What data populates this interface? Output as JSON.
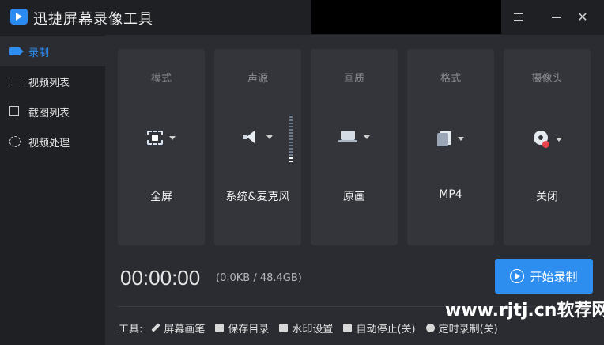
{
  "app": {
    "title": "迅捷屏幕录像工具",
    "icon": "video-camera-icon"
  },
  "window_controls": {
    "menu_icon": "hamburger-icon",
    "minimize_icon": "minimize-icon",
    "close_label": "✕"
  },
  "sidebar": {
    "items": [
      {
        "label": "录制",
        "icon": "video-camera-icon",
        "active": true
      },
      {
        "label": "视频列表",
        "icon": "list-icon",
        "active": false
      },
      {
        "label": "截图列表",
        "icon": "crop-icon",
        "active": false
      },
      {
        "label": "视频处理",
        "icon": "tools-icon",
        "active": false
      }
    ]
  },
  "settings": [
    {
      "label": "模式",
      "value": "全屏",
      "icon": "fullscreen-icon"
    },
    {
      "label": "声源",
      "value": "系统&麦克风",
      "icon": "speaker-icon",
      "volume_level": 0.1
    },
    {
      "label": "画质",
      "value": "原画",
      "icon": "laptop-icon"
    },
    {
      "label": "格式",
      "value": "MP4",
      "icon": "file-icon"
    },
    {
      "label": "摄像头",
      "value": "关闭",
      "icon": "webcam-off-icon"
    }
  ],
  "recording": {
    "timer": "00:00:00",
    "storage": "(0.0KB / 48.4GB)",
    "start_label": "开始录制"
  },
  "toolbar": {
    "label": "工具:",
    "items": [
      {
        "label": "屏幕画笔",
        "icon": "pen-icon"
      },
      {
        "label": "保存目录",
        "icon": "folder-icon"
      },
      {
        "label": "水印设置",
        "icon": "watermark-icon"
      },
      {
        "label": "自动停止(关)",
        "icon": "pause-icon"
      },
      {
        "label": "定时录制(关)",
        "icon": "clock-icon"
      }
    ]
  },
  "watermark": {
    "text": "www.rjtj.cn软荐网"
  },
  "colors": {
    "accent": "#2d8ef0",
    "background": "#1f2024",
    "panel": "#2a2c31",
    "card": "#33353a"
  }
}
